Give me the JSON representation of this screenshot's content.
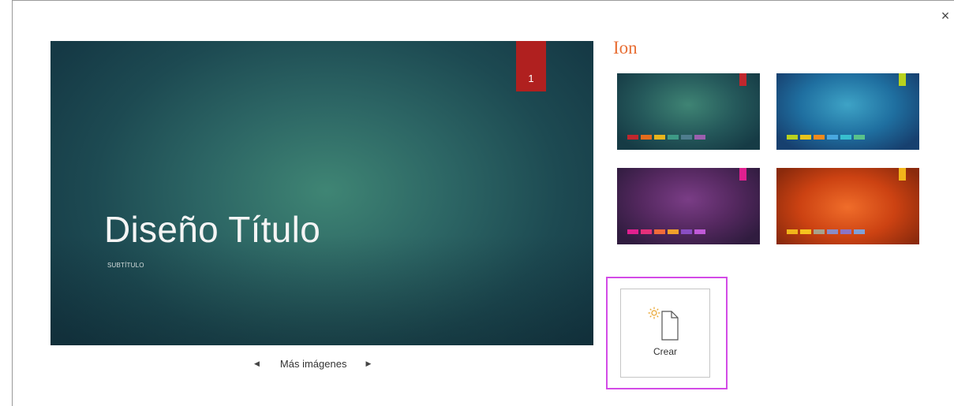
{
  "dialog": {
    "close_label": "×"
  },
  "preview": {
    "slide_number": "1",
    "title": "Diseño Título",
    "subtitle": "SUBTÍTULO"
  },
  "nav": {
    "prev_icon": "◀",
    "label": "Más imágenes",
    "next_icon": "▶"
  },
  "theme": {
    "name": "Ion",
    "variants": [
      {
        "tag": "#c0272d",
        "swatches": [
          "#c0272d",
          "#e46c1c",
          "#e8b51c",
          "#3e9a86",
          "#4f7d8e",
          "#9b5fae"
        ]
      },
      {
        "tag": "#b8d21e",
        "swatches": [
          "#b8d21e",
          "#e8c41c",
          "#f08a1c",
          "#49a8e0",
          "#38bfcf",
          "#59c28a"
        ]
      },
      {
        "tag": "#e0208f",
        "swatches": [
          "#e0208f",
          "#e4307a",
          "#f06b3a",
          "#f0a02a",
          "#8a4ec4",
          "#c05ad8"
        ]
      },
      {
        "tag": "#f2b51a",
        "swatches": [
          "#f2b51a",
          "#f5c31e",
          "#a8a28c",
          "#8a8cc6",
          "#8c74c4",
          "#7fa0d8"
        ]
      }
    ]
  },
  "create": {
    "label": "Crear"
  }
}
